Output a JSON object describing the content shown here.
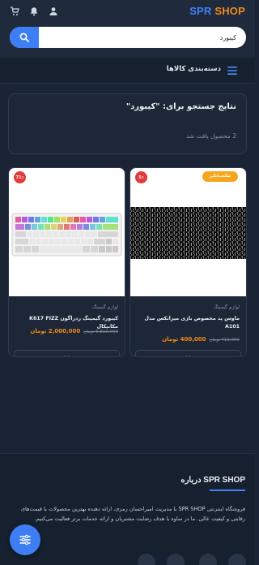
{
  "brand": {
    "first": "SPR",
    "second": "SHOP"
  },
  "search": {
    "value": "کیبورد",
    "icon": "search-icon"
  },
  "header_icons": [
    "user-icon",
    "bell-icon",
    "cart-icon"
  ],
  "categories": {
    "label": "دسته‌بندی کالاها",
    "icon": "hamburger-icon"
  },
  "results": {
    "title": "نتایج جستجو برای: \"کیبورد\"",
    "count": "2 محصول یافت شد"
  },
  "products": [
    {
      "badge": "5٪",
      "amazing": "شگفت‌انگیز",
      "category": "لوازم گیمینگ",
      "name": "ماوس پد مخصوص بازی میزانکس مدل A101",
      "price": "400,000 تومان",
      "old_price": "419,000 تومان"
    },
    {
      "badge": "71٪",
      "category": "لوازم گیمینگ",
      "name": "کیبورد گیمینگ ردراگون K617 FIZZ مکانیکال",
      "price": "2,000,000 تومان",
      "old_price": "6,819,000 تومان"
    }
  ],
  "footer": {
    "title": "درباره SPR SHOP",
    "text": "فروشگاه اینترنتی SPR SHOP با مدیریت امیراحسان رمزی، ارائه دهنده بهترین محصولات با قیمت‌های رقابتی و کیفیت عالی. ما در ساوه با هدف رضایت مشتریان و ارائه خدمات برتر فعالیت می‌کنیم."
  },
  "colors": {
    "accent": "#3e82f7",
    "orange": "#f08a1c",
    "badge_red": "#e63a3a",
    "amazing": "#f6a61c"
  }
}
